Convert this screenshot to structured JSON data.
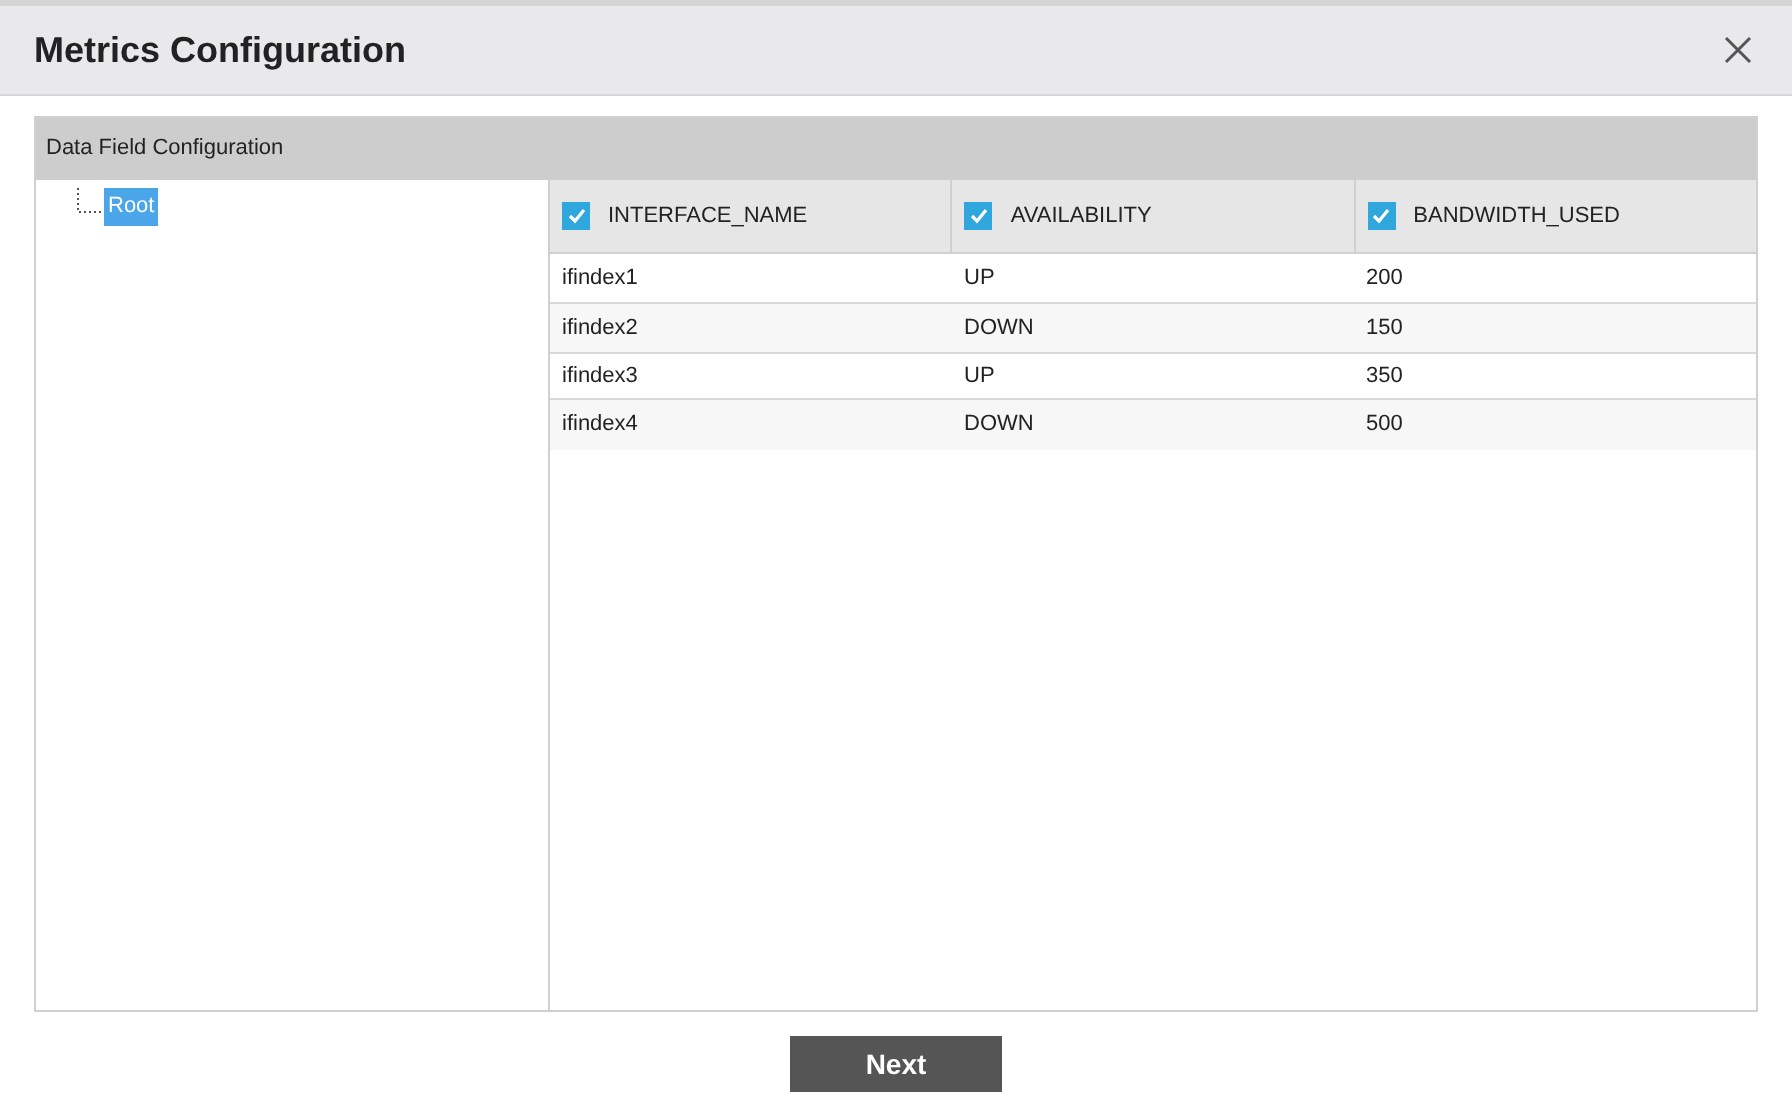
{
  "dialog": {
    "title": "Metrics Configuration"
  },
  "panel": {
    "title": "Data Field Configuration"
  },
  "tree": {
    "items": [
      {
        "label": "Root",
        "selected": true
      }
    ]
  },
  "table": {
    "columns": [
      {
        "label": "INTERFACE_NAME",
        "checked": true
      },
      {
        "label": "AVAILABILITY",
        "checked": true
      },
      {
        "label": "BANDWIDTH_USED",
        "checked": true
      }
    ],
    "rows": [
      [
        "ifindex1",
        "UP",
        "200"
      ],
      [
        "ifindex2",
        "DOWN",
        "150"
      ],
      [
        "ifindex3",
        "UP",
        "350"
      ],
      [
        "ifindex4",
        "DOWN",
        "500"
      ]
    ]
  },
  "buttons": [
    {
      "label": "Next"
    }
  ]
}
